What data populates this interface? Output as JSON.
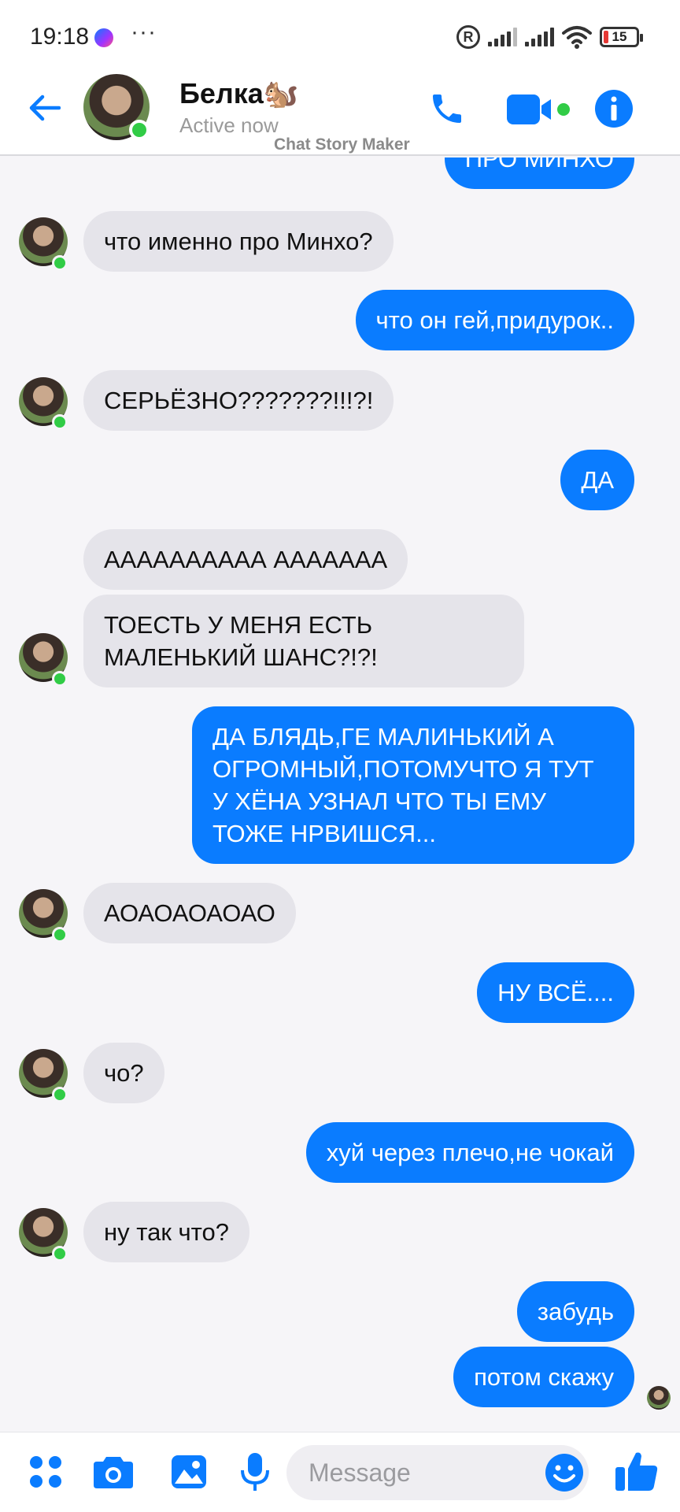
{
  "status_bar": {
    "time": "19:18",
    "overflow": "···",
    "registered_mark": "R",
    "battery_level": "15"
  },
  "header": {
    "contact_name": "Белка🐿️",
    "contact_status": "Active now",
    "watermark": "Chat Story Maker"
  },
  "colors": {
    "accent": "#0a7cff",
    "incoming_bubble": "#e5e4ea",
    "online": "#31cc46"
  },
  "messages": [
    {
      "side": "out",
      "text": "ПРО МИНХО"
    },
    {
      "side": "in",
      "text": "что именно про Минхо?"
    },
    {
      "side": "out",
      "text": "что он гей,придурок.."
    },
    {
      "side": "in",
      "text": "СЕРЬЁЗНО???????!!!?!"
    },
    {
      "side": "out",
      "text": "ДА"
    },
    {
      "side": "in",
      "text": "АААААААААА ААААААА"
    },
    {
      "side": "in",
      "text": "ТОЕСТЬ У МЕНЯ ЕСТЬ МАЛЕНЬКИЙ ШАНС?!?!"
    },
    {
      "side": "out",
      "text": "ДА БЛЯДЬ,ГЕ МАЛИНЬКИЙ А ОГРОМНЫЙ,ПОТОМУЧТО Я ТУТ У ХЁНА УЗНАЛ ЧТО ТЫ ЕМУ ТОЖЕ НРВИШСЯ..."
    },
    {
      "side": "in",
      "text": "АОАОАОАОАО"
    },
    {
      "side": "out",
      "text": "НУ ВСЁ...."
    },
    {
      "side": "in",
      "text": "чо?"
    },
    {
      "side": "out",
      "text": "хуй через плечо,не чокай"
    },
    {
      "side": "in",
      "text": "ну так что?"
    },
    {
      "side": "out",
      "text": "забудь"
    },
    {
      "side": "out",
      "text": "потом скажу"
    }
  ],
  "composer": {
    "placeholder": "Message",
    "icons": [
      "apps-icon",
      "camera-icon",
      "gallery-icon",
      "microphone-icon",
      "emoji-icon",
      "like-icon"
    ]
  }
}
